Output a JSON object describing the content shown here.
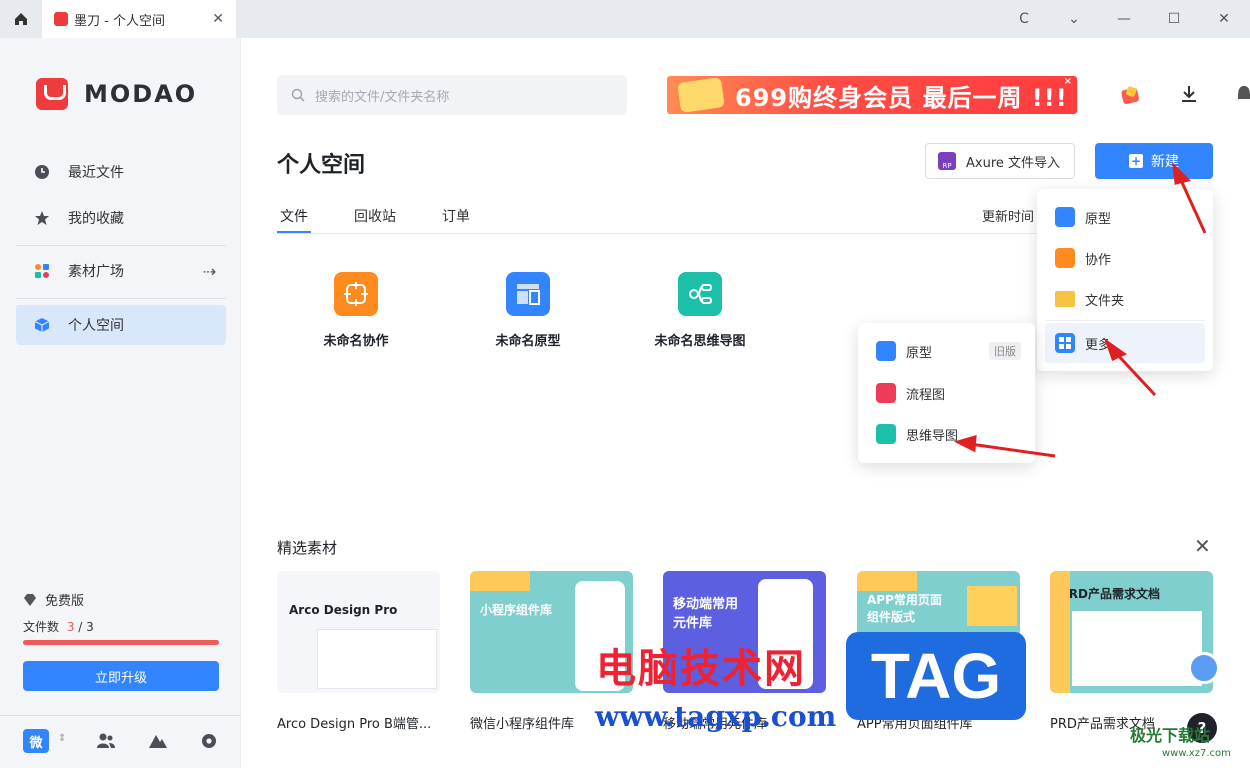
{
  "window": {
    "tab_title": "墨刀 - 个人空间",
    "close": "✕",
    "refresh": "C",
    "dropdown": "⌄",
    "minimize": "—",
    "maximize": "☐",
    "win_close": "✕"
  },
  "brand": {
    "name": "MODAO"
  },
  "sidebar": {
    "items": [
      {
        "label": "最近文件",
        "icon": "clock-icon"
      },
      {
        "label": "我的收藏",
        "icon": "star-icon"
      },
      {
        "label": "素材广场",
        "icon": "grid-apps-icon",
        "arrow": "⇢"
      },
      {
        "label": "个人空间",
        "icon": "cube-icon"
      }
    ],
    "plan": "免费版",
    "files_label": "文件数",
    "files_used": "3",
    "files_sep": " / ",
    "files_total": "3",
    "files_ratio": 1.0,
    "upgrade": "立即升级",
    "wei": "微"
  },
  "search": {
    "placeholder": "搜索的文件/文件夹名称"
  },
  "banner": {
    "text": "699购终身会员 最后一周 !!!",
    "close": "×"
  },
  "page": {
    "title": "个人空间",
    "axure_label": "Axure 文件导入",
    "axure_icon": "RP",
    "new_label": "新建",
    "new_icon": "+"
  },
  "tabs": [
    {
      "label": "文件"
    },
    {
      "label": "回收站"
    },
    {
      "label": "订单"
    }
  ],
  "sort_label": "更新时间",
  "files": [
    {
      "label": "未命名协作",
      "color": "#ff8a1e"
    },
    {
      "label": "未命名原型",
      "color": "#3385ff"
    },
    {
      "label": "未命名思维导图",
      "color": "#1cc0a8"
    }
  ],
  "new_menu": [
    {
      "label": "原型",
      "color": "#3385ff"
    },
    {
      "label": "协作",
      "color": "#ff8a1e"
    },
    {
      "label": "文件夹",
      "color": "#f5c242"
    },
    {
      "label": "更多",
      "color": "#3385ff"
    }
  ],
  "more_menu": [
    {
      "label": "原型",
      "badge": "旧版",
      "color": "#3385ff"
    },
    {
      "label": "流程图",
      "color": "#ef3b5a"
    },
    {
      "label": "思维导图",
      "color": "#1cc0a8"
    }
  ],
  "materials": {
    "title": "精选素材",
    "close": "✕",
    "cards": [
      {
        "label": "Arco Design Pro B端管...",
        "inner": "Arco Design Pro",
        "bg": "#f4f6fa"
      },
      {
        "label": "微信小程序组件库",
        "inner": "小程序组件库",
        "bg": "#7fcfcf"
      },
      {
        "label": "移动端常用元件库",
        "inner": "移动端常用 元件库",
        "bg": "#5b5fe0"
      },
      {
        "label": "APP常用页面组件库",
        "inner": "APP常用页面 组件版式",
        "bg": "#7fcfcf"
      },
      {
        "label": "PRD产品需求文档",
        "inner": "PRD产品需求文档",
        "bg": "#7fcfcf"
      }
    ]
  },
  "overlay": {
    "cn_watermark": "电脑技术网",
    "url_watermark": "www.tagxp.com",
    "tag": "TAG",
    "help": "?",
    "site": "极光下载站",
    "site_url": "www.xz7.com"
  }
}
